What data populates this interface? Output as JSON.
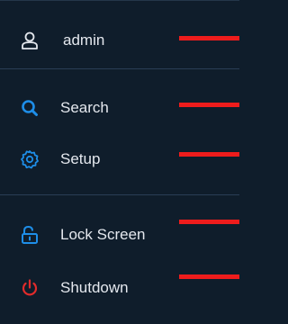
{
  "menu": {
    "items": [
      {
        "label": "admin",
        "icon": "user-icon"
      },
      {
        "label": "Search",
        "icon": "search-icon"
      },
      {
        "label": "Setup",
        "icon": "gear-icon"
      },
      {
        "label": "Lock Screen",
        "icon": "unlock-icon"
      },
      {
        "label": "Shutdown",
        "icon": "power-icon"
      }
    ]
  },
  "colors": {
    "background": "#0f1d2b",
    "divider": "#2a3e55",
    "text": "#e4e8ee",
    "accent_blue": "#1e8ee8",
    "power_red": "#e02b2b",
    "marker_red": "#ee1c1c"
  }
}
